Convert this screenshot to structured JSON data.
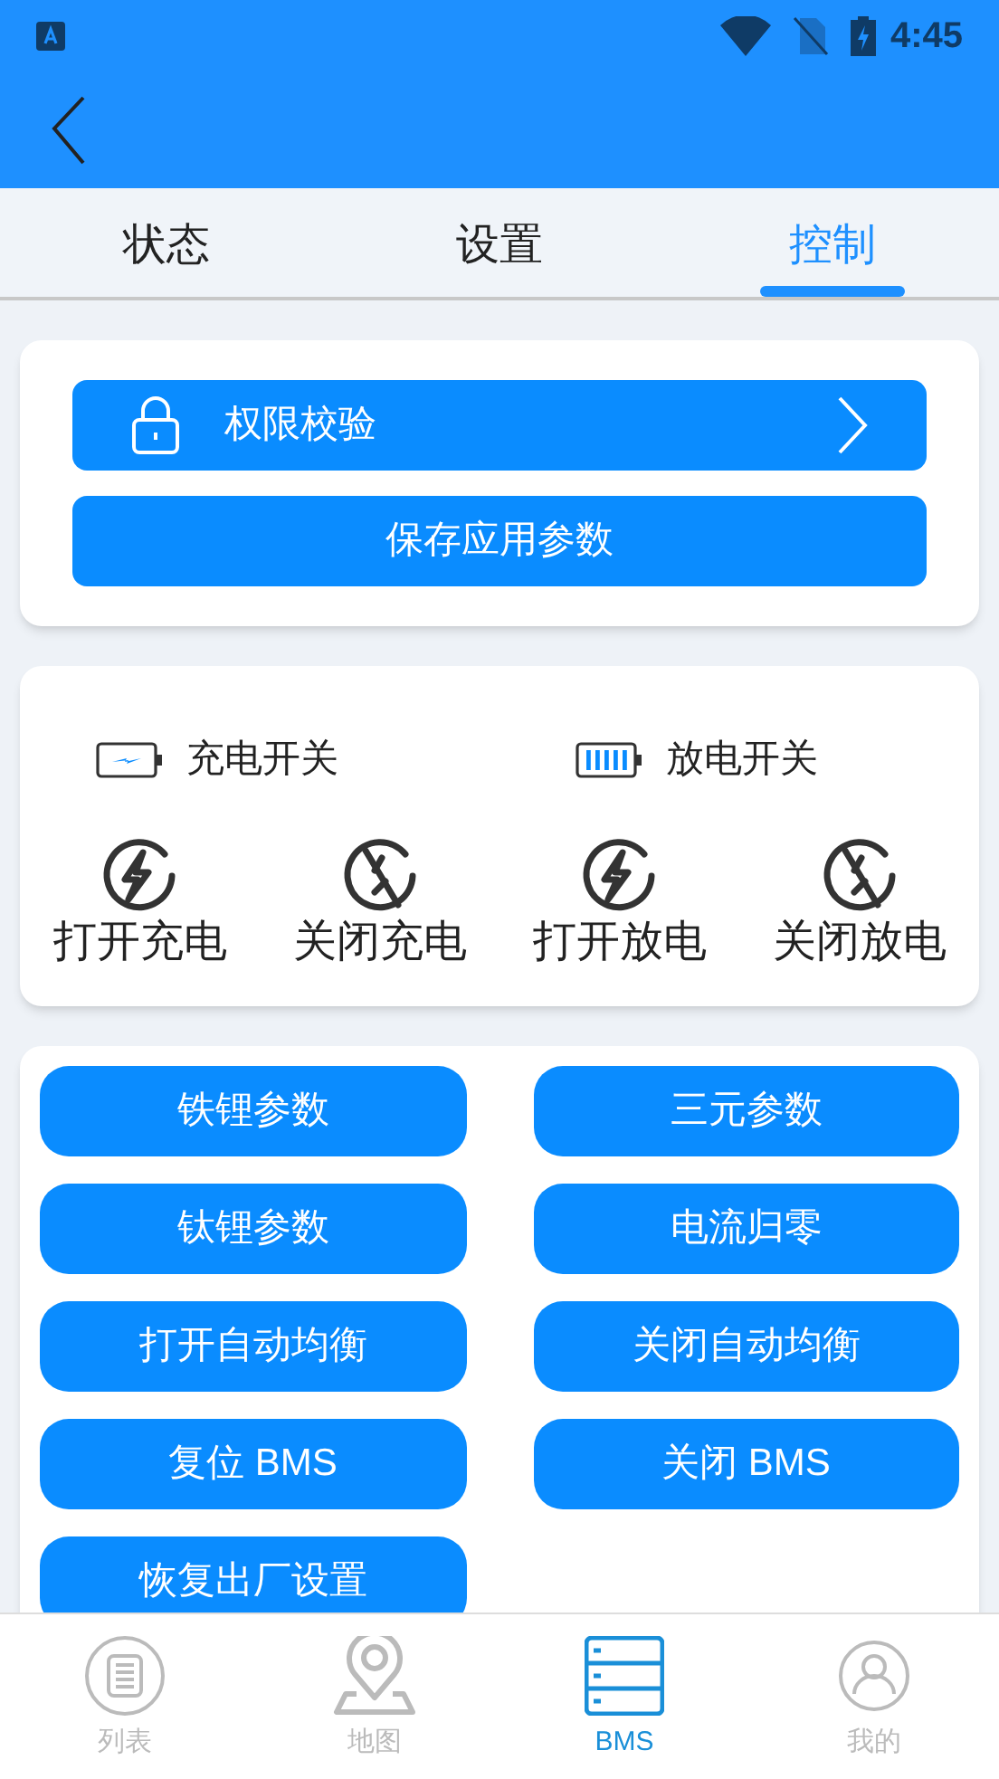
{
  "status_bar": {
    "time": "4:45"
  },
  "tabs": [
    {
      "label": "状态",
      "selected": false
    },
    {
      "label": "设置",
      "selected": false
    },
    {
      "label": "控制",
      "selected": true
    }
  ],
  "auth_button": {
    "label": "权限校验"
  },
  "save_button": {
    "label": "保存应用参数"
  },
  "switches": [
    {
      "kind": "charge",
      "label": "充电开关",
      "actions": [
        {
          "kind": "on",
          "label": "打开充电"
        },
        {
          "kind": "off",
          "label": "关闭充电"
        }
      ]
    },
    {
      "kind": "discharge",
      "label": "放电开关",
      "actions": [
        {
          "kind": "on",
          "label": "打开放电"
        },
        {
          "kind": "off",
          "label": "关闭放电"
        }
      ]
    }
  ],
  "commands": [
    "铁锂参数",
    "三元参数",
    "钛锂参数",
    "电流归零",
    "打开自动均衡",
    "关闭自动均衡",
    "复位 BMS",
    "关闭 BMS",
    "恢复出厂设置"
  ],
  "bottom_nav": [
    {
      "kind": "list",
      "label": "列表",
      "selected": false
    },
    {
      "kind": "map",
      "label": "地图",
      "selected": false
    },
    {
      "kind": "bms",
      "label": "BMS",
      "selected": true
    },
    {
      "kind": "user",
      "label": "我的",
      "selected": false
    }
  ]
}
